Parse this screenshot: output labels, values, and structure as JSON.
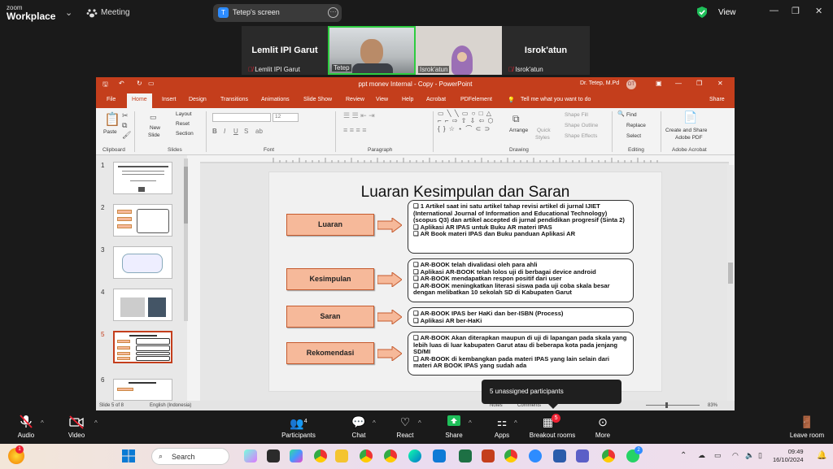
{
  "zoom": {
    "logo_line1": "zoom",
    "logo_line2": "Workplace",
    "meeting_label": "Meeting",
    "share_label": "Tetep's screen",
    "share_badge": "T",
    "view_label": "View",
    "accent": "#2d8cff",
    "participants": [
      {
        "big_name": "Lemlit IPI Garut",
        "label": "Lemlit IPI Garut"
      },
      {
        "big_name": "",
        "label": "Tetep"
      },
      {
        "big_name": "",
        "label": "Isrok'atun"
      },
      {
        "big_name": "Isrok'atun",
        "label": "Isrok'atun"
      }
    ],
    "toolbar": {
      "audio": "Audio",
      "video": "Video",
      "participants": "Participants",
      "participants_count": "4",
      "chat": "Chat",
      "react": "React",
      "share": "Share",
      "apps": "Apps",
      "breakout": "Breakout rooms",
      "breakout_badge": "5",
      "more": "More",
      "leave": "Leave room"
    },
    "tooltip": "5 unassigned participants"
  },
  "ppt": {
    "title": "ppt monev Internal - Copy - PowerPoint",
    "user": "Dr. Tetep, M.Pd",
    "user_initials": "DT",
    "brand_color": "#c43e1c",
    "tabs": [
      "File",
      "Home",
      "Insert",
      "Design",
      "Transitions",
      "Animations",
      "Slide Show",
      "Review",
      "View",
      "Help",
      "Acrobat",
      "PDFelement"
    ],
    "tell_me": "Tell me what you want to do",
    "share": "Share",
    "ribbon": {
      "paste": "Paste",
      "clipboard": "Clipboard",
      "new_slide_1": "New",
      "new_slide_2": "Slide",
      "layout": "Layout",
      "reset": "Reset",
      "section": "Section",
      "slides": "Slides",
      "font_size": "12",
      "font": "Font",
      "paragraph": "Paragraph",
      "arrange": "Arrange",
      "quick_styles_1": "Quick",
      "quick_styles_2": "Styles",
      "shape_fill": "Shape Fill",
      "shape_outline": "Shape Outline",
      "shape_effects": "Shape Effects",
      "drawing": "Drawing",
      "find": "Find",
      "replace": "Replace",
      "select": "Select",
      "editing": "Editing",
      "adobe_1": "Create and Share",
      "adobe_2": "Adobe PDF",
      "adobe_group": "Adobe Acrobat"
    },
    "thumbnails": [
      "1",
      "2",
      "3",
      "4",
      "5",
      "6"
    ],
    "selected_thumb": "5",
    "status": {
      "slide_of": "Slide 5 of 8",
      "language": "English (Indonesia)",
      "notes": "Notes",
      "comments": "Comments",
      "zoom": "83%"
    },
    "slide": {
      "title": "Luaran Kesimpulan dan Saran",
      "rows": [
        {
          "label": "Luaran",
          "items": [
            "1 Artikel saat ini satu artikel tahap revisi artikel di jurnal IJIET (International Journal of Information and Educational Technology) (scopus Q3) dan artikel accepted di jurnal pendidikan progresif (Sinta 2)",
            "Aplikasi AR IPAS untuk Buku AR materi IPAS",
            "AR Book materi IPAS dan Buku panduan Aplikasi AR"
          ]
        },
        {
          "label": "Kesimpulan",
          "items": [
            "AR-BOOK telah divalidasi oleh para ahli",
            "Aplikasi AR-BOOK telah lolos uji di berbagai device android",
            "AR-BOOK mendapatkan respon positif dari user",
            "AR-BOOK meningkatkan literasi siswa pada uji coba skala besar dengan melibatkan 10 sekolah SD di Kabupaten Garut"
          ]
        },
        {
          "label": "Saran",
          "items": [
            "AR-BOOK IPAS ber HaKi dan ber-ISBN (Process)",
            "Aplikasi AR ber-HaKi"
          ]
        },
        {
          "label": "Rekomendasi",
          "items": [
            "AR-BOOK Akan diterapkan maupun di uji di lapangan pada skala yang lebih luas di luar kabupaten Garut atau di beberapa kota pada jenjang SD/MI",
            "AR-BOOK di kembangkan pada materi IPAS yang lain selain dari materi AR BOOK IPAS yang sudah ada"
          ]
        }
      ]
    }
  },
  "taskbar": {
    "search_placeholder": "Search",
    "time": "09:49",
    "date": "16/10/2024",
    "badge": "2"
  }
}
